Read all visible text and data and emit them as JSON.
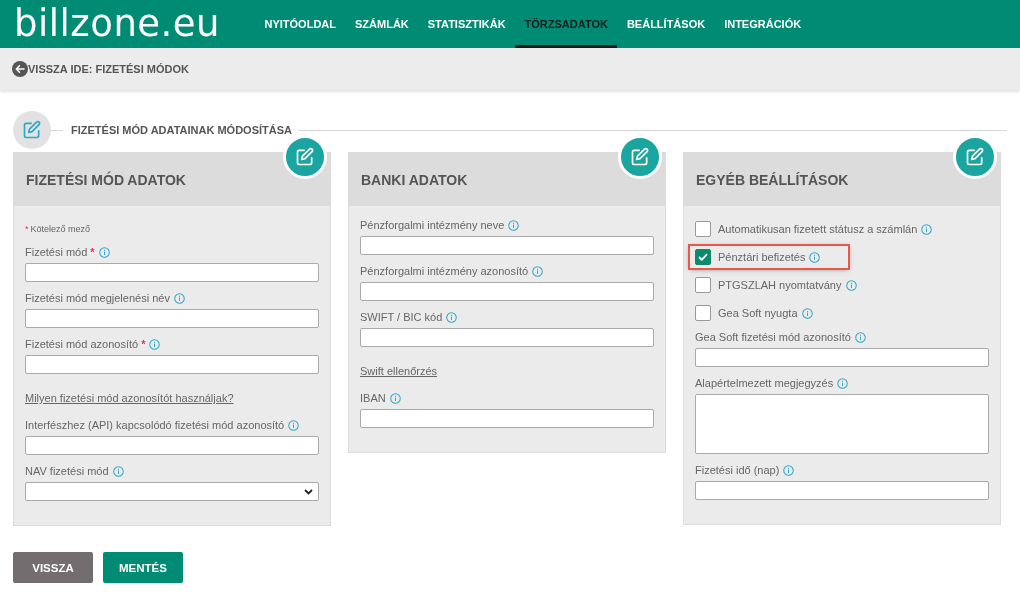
{
  "header": {
    "logo": "billzone.eu",
    "nav": [
      {
        "label": "NYITÓOLDAL",
        "selected": false
      },
      {
        "label": "SZÁMLÁK",
        "selected": false
      },
      {
        "label": "STATISZTIKÁK",
        "selected": false
      },
      {
        "label": "TÖRZSADATOK",
        "selected": true
      },
      {
        "label": "BEÁLLÍTÁSOK",
        "selected": false
      },
      {
        "label": "INTEGRÁCIÓK",
        "selected": false
      }
    ]
  },
  "breadcrumb": {
    "label": "VISSZA IDE: FIZETÉSI MÓDOK"
  },
  "section_title": "FIZETÉSI MÓD ADATAINAK MÓDOSÍTÁSA",
  "panels": [
    {
      "title": "FIZETÉSI MÓD ADATOK",
      "items": [
        {
          "kind": "note",
          "marker": "*",
          "text": "Kötelező mező"
        },
        {
          "kind": "field",
          "label": "Fizetési mód",
          "marker": "*",
          "info": true
        },
        {
          "kind": "field",
          "label": "Fizetési mód megjelenési név",
          "info": true
        },
        {
          "kind": "field",
          "label": "Fizetési mód azonosító",
          "marker": "*",
          "info": true
        },
        {
          "kind": "link",
          "text": "Milyen fizetési mód azonosítót használjak?"
        },
        {
          "kind": "field",
          "label": "Interfészhez (API) kapcsolódó fizetési mód azonosító",
          "info": true
        },
        {
          "kind": "select",
          "label": "NAV fizetési mód",
          "info": true
        }
      ]
    },
    {
      "title": "BANKI ADATOK",
      "items": [
        {
          "kind": "field",
          "label": "Pénzforgalmi intézmény neve",
          "info": true
        },
        {
          "kind": "field",
          "label": "Pénzforgalmi intézmény azonosító",
          "info": true
        },
        {
          "kind": "field",
          "label": "SWIFT / BIC kód",
          "info": true
        },
        {
          "kind": "link",
          "text": "Swift ellenőrzés"
        },
        {
          "kind": "field",
          "label": "IBAN",
          "info": true
        }
      ]
    },
    {
      "title": "EGYÉB BEÁLLÍTÁSOK",
      "items": [
        {
          "kind": "checkbox",
          "label": "Automatikusan fizetett státusz a számlán",
          "checked": false,
          "highlighted": false,
          "info": true
        },
        {
          "kind": "checkbox",
          "label": "Pénztári befizetés",
          "checked": true,
          "highlighted": true,
          "info": true
        },
        {
          "kind": "checkbox",
          "label": "PTGSZLAH nyomtatvány",
          "checked": false,
          "highlighted": false,
          "info": true
        },
        {
          "kind": "checkbox",
          "label": "Gea Soft nyugta",
          "checked": false,
          "highlighted": false,
          "info": true
        },
        {
          "kind": "field",
          "label": "Gea Soft fizetési mód azonosító",
          "info": true
        },
        {
          "kind": "textarea",
          "label": "Alapértelmezett megjegyzés",
          "info": true
        },
        {
          "kind": "field",
          "label": "Fizetési idő (nap)",
          "info": true
        }
      ]
    }
  ],
  "buttons": [
    {
      "label": "VISSZA",
      "kind": "secondary"
    },
    {
      "label": "MENTÉS",
      "kind": "primary"
    }
  ]
}
